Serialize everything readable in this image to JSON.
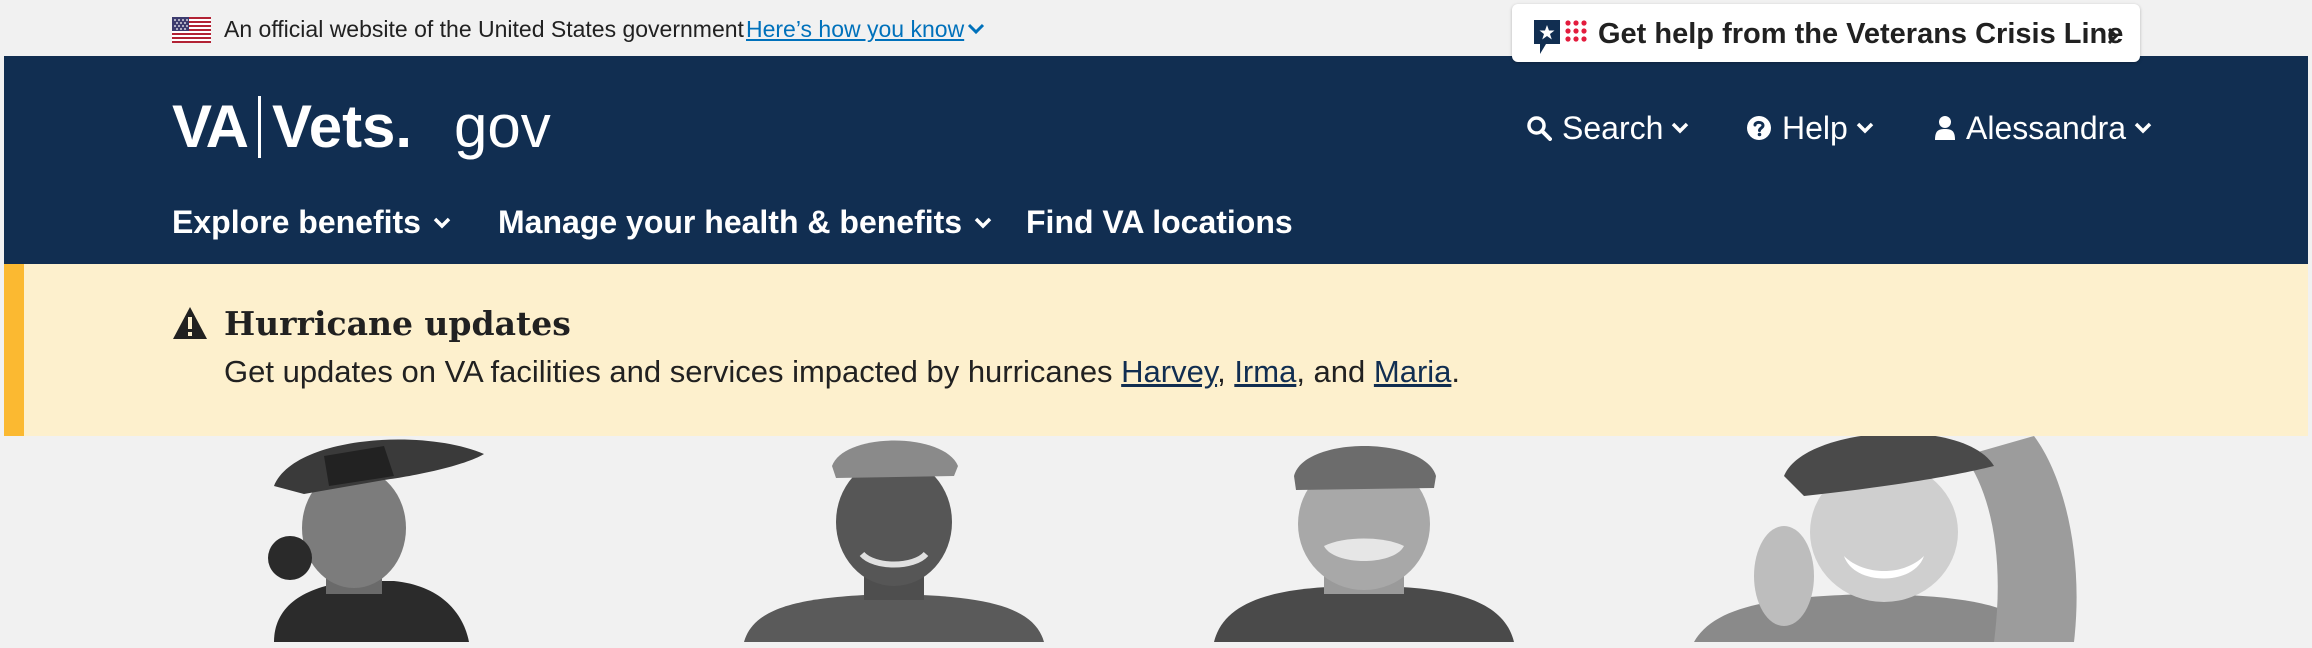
{
  "gov_banner": {
    "official_text": "An official website of the United States government",
    "how_you_know": "Here’s how you know"
  },
  "crisis_line": {
    "label": "Get help from the Veterans Crisis Line"
  },
  "header": {
    "logo_va": "VA",
    "logo_vets": "Vets.",
    "logo_gov": "gov",
    "utility": {
      "search": "Search",
      "help": "Help",
      "user": "Alessandra"
    },
    "nav": {
      "explore": "Explore benefits",
      "manage": "Manage your health & benefits",
      "find": "Find VA locations"
    }
  },
  "alert": {
    "title": "Hurricane updates",
    "body_prefix": "Get updates on VA facilities and services impacted by hurricanes ",
    "link_harvey": "Harvey",
    "sep1": ", ",
    "link_irma": "Irma",
    "sep2": ", and ",
    "link_maria": "Maria",
    "body_suffix": "."
  },
  "colors": {
    "header_bg": "#112e51",
    "alert_bg": "#fdf0cd",
    "alert_stripe": "#fbb931",
    "link": "#0071bb",
    "crisis_red": "#e31c3d"
  }
}
